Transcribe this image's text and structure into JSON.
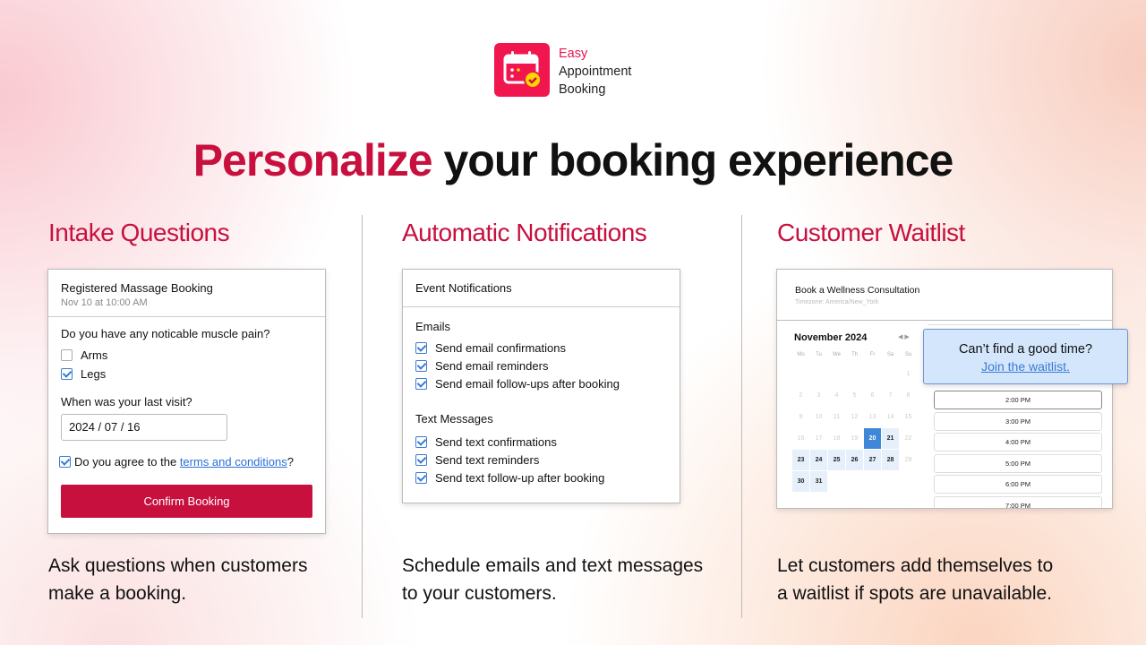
{
  "brand": {
    "line1": "Easy",
    "line2": "Appointment",
    "line3": "Booking",
    "accent": "#f2164f"
  },
  "headline": {
    "highlight": "Personalize",
    "rest": " your booking experience"
  },
  "columns": [
    {
      "title": "Intake Questions",
      "caption1": "Ask questions when customers",
      "caption2": "make a booking."
    },
    {
      "title": "Automatic Notifications",
      "caption1": "Schedule emails and text messages",
      "caption2": "to your customers."
    },
    {
      "title": "Customer Waitlist",
      "caption1": "Let customers add themselves to",
      "caption2": "a waitlist if spots are unavailable."
    }
  ],
  "intake": {
    "title": "Registered Massage Booking",
    "date": "Nov 10 at 10:00 AM",
    "q1": "Do you have any noticable muscle pain?",
    "options": [
      {
        "label": "Arms",
        "checked": false
      },
      {
        "label": "Legs",
        "checked": true
      }
    ],
    "q2": "When was your last visit?",
    "visit_value": "2024 / 07 / 16",
    "agree_prefix": "Do you agree to the ",
    "agree_link": "terms and conditions",
    "agree_suffix": "?",
    "agree_checked": true,
    "confirm": "Confirm Booking"
  },
  "notifications": {
    "title": "Event Notifications",
    "emails_heading": "Emails",
    "emails": [
      "Send email confirmations",
      "Send email reminders",
      "Send email follow-ups after booking"
    ],
    "texts_heading": "Text Messages",
    "texts": [
      "Send text confirmations",
      "Send text reminders",
      "Send text follow-up after booking"
    ]
  },
  "waitlist": {
    "title": "Book a Wellness Consultation",
    "timezone": "Timezone: America/New_York",
    "month": "November 2024",
    "weekdays": [
      "Mo",
      "Tu",
      "We",
      "Th",
      "Fr",
      "Sa",
      "Su"
    ],
    "selected_day": 20,
    "available_days": [
      20,
      21,
      23,
      24,
      25,
      26,
      27,
      28,
      30,
      31
    ],
    "slots": [
      "2:00 PM",
      "3:00 PM",
      "4:00 PM",
      "5:00 PM",
      "6:00 PM",
      "7:00 PM"
    ],
    "popup_title": "Can’t find a good time?",
    "popup_link": "Join the waitlist."
  }
}
